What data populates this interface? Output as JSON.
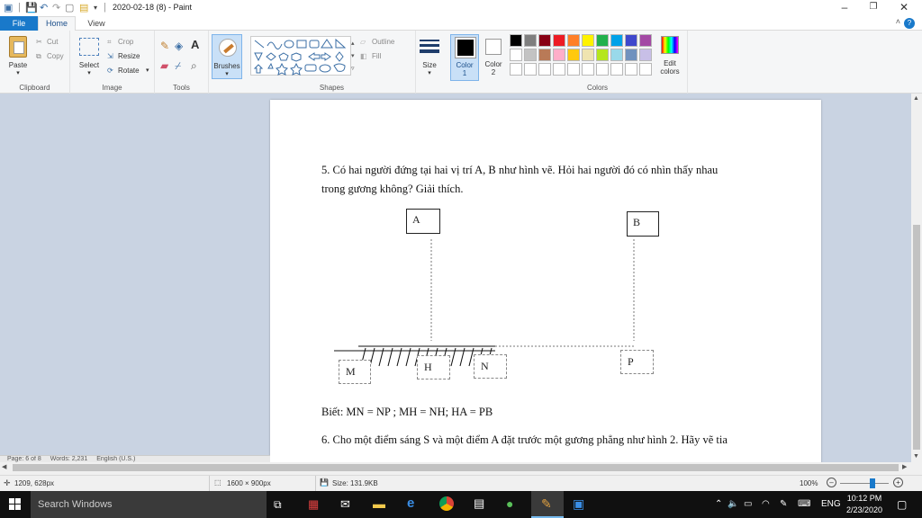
{
  "window": {
    "title": "2020-02-18 (8) - Paint"
  },
  "tabs": [
    {
      "label": "File"
    },
    {
      "label": "Home"
    },
    {
      "label": "View"
    }
  ],
  "ribbon": {
    "clipboard": {
      "paste": "Paste",
      "cut": "Cut",
      "copy": "Copy",
      "group_label": "Clipboard"
    },
    "image": {
      "select": "Select",
      "crop": "Crop",
      "resize": "Resize",
      "rotate": "Rotate",
      "group_label": "Image"
    },
    "tools": {
      "group_label": "Tools"
    },
    "brushes": {
      "label": "Brushes"
    },
    "shapes": {
      "outline": "Outline",
      "fill": "Fill",
      "group_label": "Shapes"
    },
    "size": {
      "label": "Size"
    },
    "color1": {
      "label": "Color",
      "num": "1"
    },
    "color2": {
      "label": "Color",
      "num": "2"
    },
    "colors": {
      "group_label": "Colors",
      "edit_line1": "Edit",
      "edit_line2": "colors"
    },
    "palette_row1": [
      "#000000",
      "#7f7f7f",
      "#880015",
      "#ed1c24",
      "#ff7f27",
      "#fff200",
      "#22b14c",
      "#00a2e8",
      "#3f48cc",
      "#a349a4"
    ],
    "palette_row2": [
      "#ffffff",
      "#c3c3c3",
      "#b97a57",
      "#ffaec9",
      "#ffc90e",
      "#efe4b0",
      "#b5e61d",
      "#99d9ea",
      "#7092be",
      "#c8bfe7"
    ]
  },
  "document": {
    "question5_line1": "5. Có hai người đứng tại hai vị trí A, B như hình vẽ. Hỏi hai người đó có nhìn thấy nhau",
    "question5_line2": "trong gương không? Giải thích.",
    "figure": {
      "A": "A",
      "B": "B",
      "M": "M",
      "H": "H",
      "N": "N",
      "P": "P"
    },
    "given": "Biết: MN = NP ; MH = NH; HA = PB",
    "question6_line1": "6. Cho một điểm sáng S và một điểm A đặt trước một gương phẳng như hình 2. Hãy vẽ tia"
  },
  "word_status": {
    "page": "Page: 6 of 8",
    "words": "Words: 2,231",
    "language": "English (U.S.)"
  },
  "statusbar": {
    "cursor_pos": "1209, 628px",
    "dimensions": "1600 × 900px",
    "size": "Size: 131.9KB",
    "zoom": "100%"
  },
  "taskbar": {
    "search": "Search Windows",
    "lang": "ENG",
    "time": "10:12 PM",
    "date": "2/23/2020"
  }
}
